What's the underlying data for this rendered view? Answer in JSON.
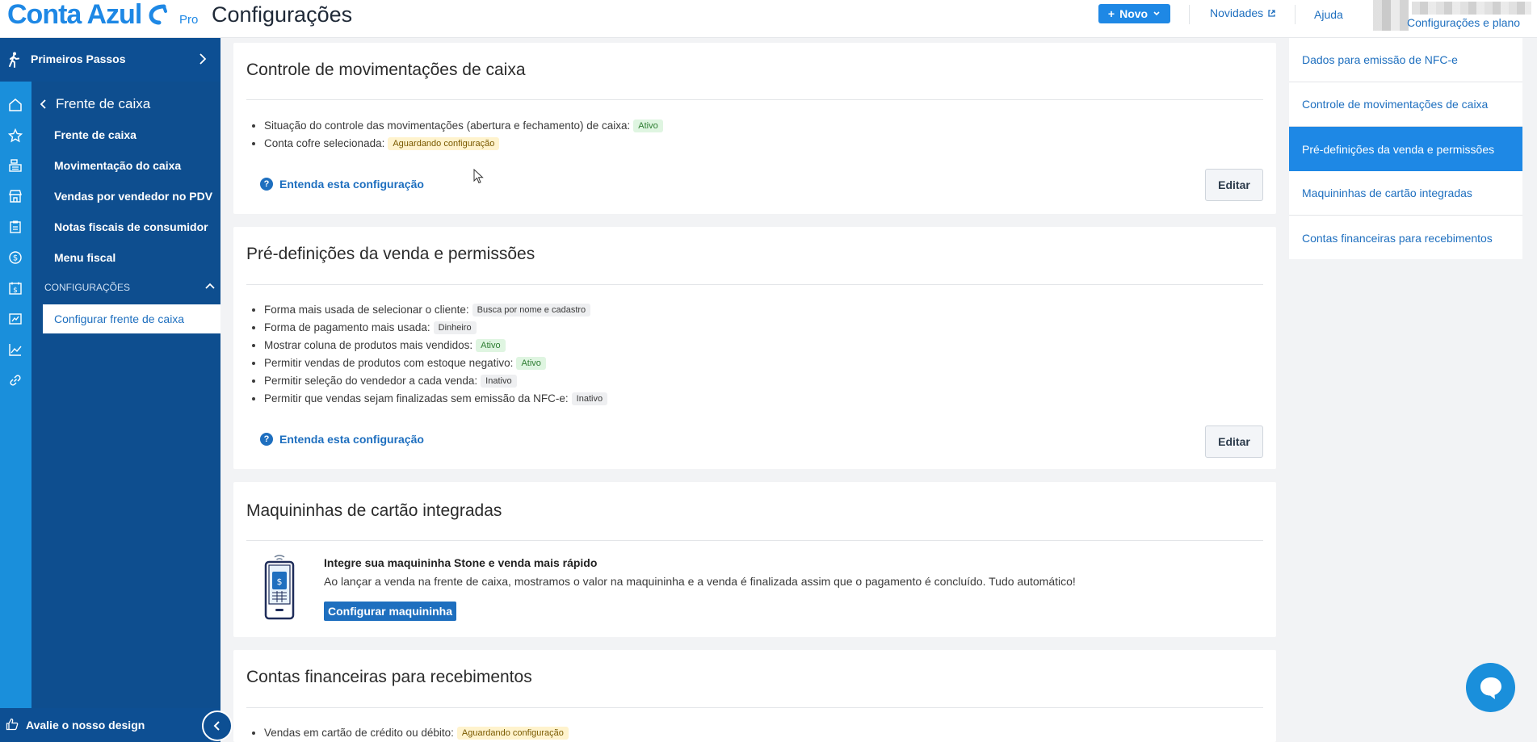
{
  "header": {
    "logo_text": "Conta Azul",
    "logo_plan": "Pro",
    "page_title": "Configurações",
    "new_button": "Novo",
    "news_link": "Novidades",
    "help_link": "Ajuda",
    "account_link": "Configurações e plano"
  },
  "sidebar": {
    "getting_started": "Primeiros Passos",
    "section_title": "Frente de caixa",
    "items": [
      {
        "label": "Frente de caixa"
      },
      {
        "label": "Movimentação do caixa"
      },
      {
        "label": "Vendas por vendedor no PDV"
      },
      {
        "label": "Notas fiscais de consumidor"
      },
      {
        "label": "Menu fiscal"
      }
    ],
    "config_section": "CONFIGURAÇÕES",
    "active_item": "Configurar frente de caixa",
    "feedback": "Avalie o nosso design"
  },
  "cards": {
    "cash_control": {
      "title": "Controle de movimentações de caixa",
      "rows": [
        {
          "label": "Situação do controle das movimentações (abertura e fechamento) de caixa:",
          "badge": "Ativo"
        },
        {
          "label": "Conta cofre selecionada:",
          "badge": "Aguardando configuração"
        }
      ],
      "help": "Entenda esta configuração",
      "edit": "Editar"
    },
    "presets": {
      "title": "Pré-definições da venda e permissões",
      "rows": [
        {
          "label": "Forma mais usada de selecionar o cliente:",
          "badge": "Busca por nome e cadastro"
        },
        {
          "label": "Forma de pagamento mais usada:",
          "badge": "Dinheiro"
        },
        {
          "label": "Mostrar coluna de produtos mais vendidos:",
          "badge": "Ativo"
        },
        {
          "label": "Permitir vendas de produtos com estoque negativo:",
          "badge": "Ativo"
        },
        {
          "label": "Permitir seleção do vendedor a cada venda:",
          "badge": "Inativo"
        },
        {
          "label": "Permitir que vendas sejam finalizadas sem emissão da NFC-e:",
          "badge": "Inativo"
        }
      ],
      "help": "Entenda esta configuração",
      "edit": "Editar"
    },
    "card_machines": {
      "title": "Maquininhas de cartão integradas",
      "promo_title": "Integre sua maquininha Stone e venda mais rápido",
      "promo_desc": "Ao lançar a venda na frente de caixa, mostramos o valor na maquininha e a venda é finalizada assim que o pagamento é concluído. Tudo automático!",
      "promo_button": "Configurar maquininha",
      "phone_symbol": "$"
    },
    "accounts": {
      "title": "Contas financeiras para recebimentos",
      "rows": [
        {
          "label": "Vendas em cartão de crédito ou débito:",
          "badge": "Aguardando configuração"
        }
      ]
    }
  },
  "right_nav": {
    "items": [
      {
        "label": "Dados para emissão de NFC-e"
      },
      {
        "label": "Controle de movimentações de caixa"
      },
      {
        "label": "Pré-definições da venda e permissões"
      },
      {
        "label": "Maquininhas de cartão integradas"
      },
      {
        "label": "Contas financeiras para recebimentos"
      }
    ],
    "active_index": 2
  },
  "colors": {
    "brand_blue": "#1e88e5",
    "sidebar_dark": "#0e4e8f",
    "rail_blue": "#1a8fdb",
    "badge_active": "#dff5e1",
    "badge_pending": "#fff3cd"
  }
}
